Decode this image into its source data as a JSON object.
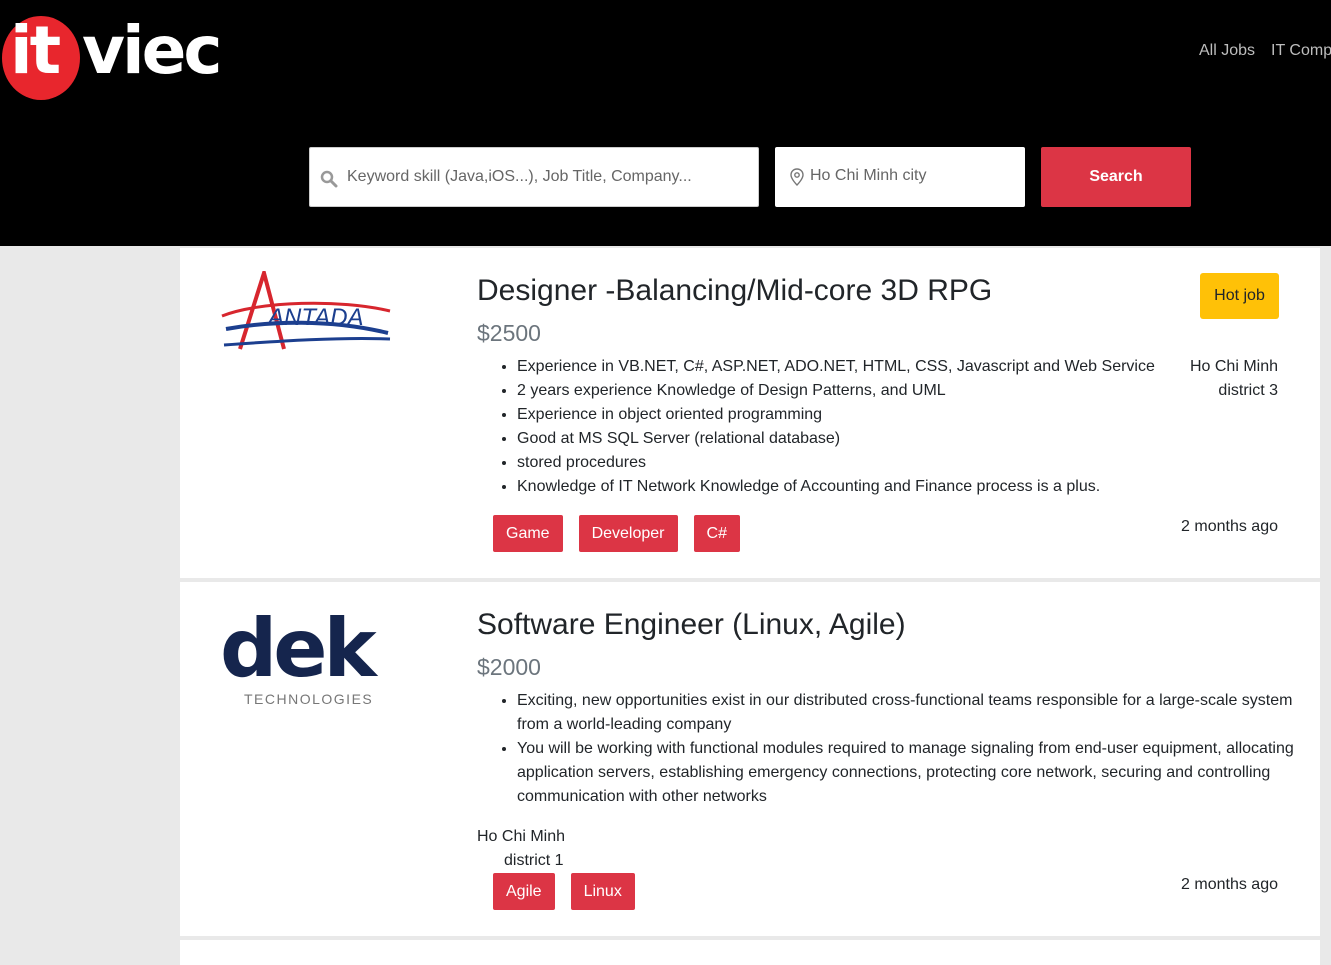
{
  "brand": {
    "logo_left": "it",
    "logo_right": "viec"
  },
  "nav": {
    "items": [
      "All Jobs",
      "IT Comp"
    ]
  },
  "search": {
    "placeholder": "Keyword skill (Java,iOS...), Job Title, Company...",
    "location": "Ho Chi Minh city",
    "button_label": "Search"
  },
  "colors": {
    "accent": "#dc3545",
    "hot": "#ffc107",
    "header_bg": "#000000"
  },
  "jobs": [
    {
      "company_logo_text": "ANTADA",
      "title": "Designer -Balancing/Mid-core 3D RPG",
      "salary": "$2500",
      "badge": "Hot job",
      "bullets": [
        "Experience in VB.NET, C#, ASP.NET, ADO.NET, HTML, CSS, Javascript and Web Service",
        "2 years experience Knowledge of Design Patterns, and UML",
        "Experience in object oriented programming",
        "Good at MS SQL Server (relational database)",
        "stored procedures",
        "Knowledge of IT Network Knowledge of Accounting and Finance process is a plus."
      ],
      "city": "Ho Chi Minh",
      "district": "district 3",
      "tags": [
        "Game",
        "Developer",
        "C#"
      ],
      "posted": "2 months ago"
    },
    {
      "company_logo_text": "dek",
      "company_logo_sub": "TECHNOLOGIES",
      "title": "Software Engineer (Linux, Agile)",
      "salary": "$2000",
      "bullets": [
        "Exciting, new opportunities exist in our distributed cross-functional teams responsible for a large-scale system from a world-leading company",
        "You will be working with functional modules required to manage signaling from end-user equipment, allocating application servers, establishing emergency connections, protecting core network, securing and controlling communication with other networks"
      ],
      "city": "Ho Chi Minh",
      "district": "district 1",
      "tags": [
        "Agile",
        "Linux"
      ],
      "posted": "2 months ago"
    }
  ]
}
